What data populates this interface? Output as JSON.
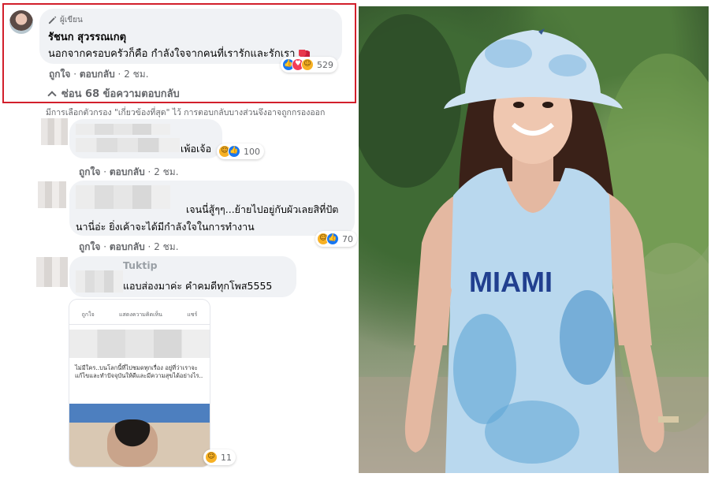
{
  "main_comment": {
    "author_tag": "ผู้เขียน",
    "author_name": "รัชนก สุวรรณเกตุ",
    "text": "นอกจากครอบครัวก็คือ กำลังใจจากคนที่เรารักและรักเรา",
    "reaction_count": "529",
    "actions": {
      "like": "ถูกใจ",
      "reply": "ตอบกลับ",
      "time": "2 ชม."
    }
  },
  "hide_replies": "ซ่อน 68 ข้อความตอบกลับ",
  "filter_note": "มีการเลือกตัวกรอง \"เกี่ยวข้องที่สุด\" ไว้ การตอบกลับบางส่วนจึงอาจถูกกรองออก",
  "replies": [
    {
      "text": "เพ้อเจ้อ",
      "reaction_count": "100",
      "actions": {
        "like": "ถูกใจ",
        "reply": "ตอบกลับ",
        "time": "2 ชม."
      }
    },
    {
      "line1": "เจนนี่สู้ๆๆ...ย้ายไปอยู่กับผัวเลยสิที่ปัต",
      "line2": "นานี่อ่ะ ยิ่งเค้าจะได้มีกำลังใจในการทำงาน",
      "reaction_count": "70",
      "actions": {
        "like": "ถูกใจ",
        "reply": "ตอบกลับ",
        "time": "2 ชม."
      }
    },
    {
      "name": "Tuktip",
      "text": "แอบส่องมาค่ะ คำคมดีทุกโพส5555",
      "reaction_count": "11"
    }
  ],
  "embedded_screenshot": {
    "bar": [
      "ถูกใจ",
      "แสดงความคิดเห็น",
      "แชร์"
    ],
    "caption": "ไม่มีใคร..บนโลกนี้ที่ไปชมดทุกเรื่อง อยู่ที่ว่าเราจะแก้ไขและทำปัจจุบันให้ดีและมีความสุขได้อย่างไร.."
  }
}
